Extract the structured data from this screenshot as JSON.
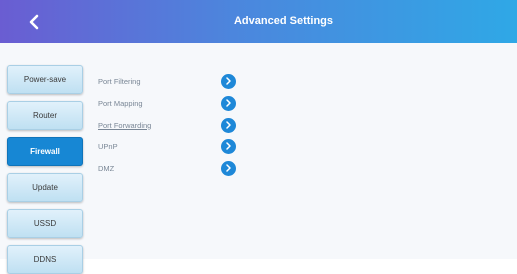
{
  "header": {
    "title": "Advanced Settings",
    "back_icon": "chevron-left-icon",
    "gradient": [
      "#6a5dd2",
      "#4c86dd",
      "#2fa8e6"
    ]
  },
  "sidebar": {
    "items": [
      {
        "label": "Power-save",
        "active": false
      },
      {
        "label": "Router",
        "active": false
      },
      {
        "label": "Firewall",
        "active": true
      },
      {
        "label": "Update",
        "active": false
      },
      {
        "label": "USSD",
        "active": false
      },
      {
        "label": "DDNS",
        "active": false
      }
    ],
    "active_color": "#1787d4"
  },
  "menu": {
    "items": [
      {
        "label": "Port Filtering",
        "icon": "chevron-right-circle-icon"
      },
      {
        "label": "Port Mapping",
        "icon": "chevron-right-circle-icon"
      },
      {
        "label": "Port Forwarding",
        "icon": "chevron-right-circle-icon",
        "underlined": true
      },
      {
        "label": "UPnP",
        "icon": "chevron-right-circle-icon"
      },
      {
        "label": "DMZ",
        "icon": "chevron-right-circle-icon"
      }
    ],
    "accent": "#1e88d8"
  }
}
